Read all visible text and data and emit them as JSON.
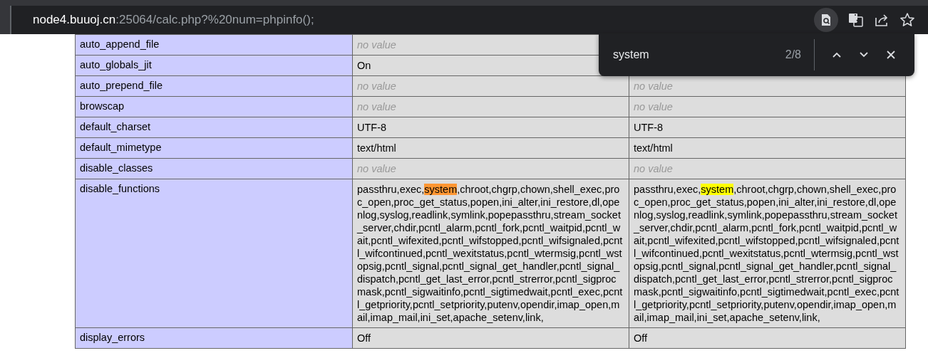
{
  "address_bar": {
    "host": "node4.buuoj.cn",
    "path": ":25064/calc.php?%20num=phpinfo();",
    "find_icon_active": true
  },
  "find_bar": {
    "query": "system",
    "count": "2/8"
  },
  "table": {
    "rows": [
      {
        "directive": "auto_append_file",
        "local": {
          "kind": "novalue",
          "text": "no value"
        }
      },
      {
        "directive": "auto_globals_jit",
        "local": {
          "kind": "plain",
          "text": "On"
        }
      },
      {
        "directive": "auto_prepend_file",
        "local": {
          "kind": "novalue",
          "text": "no value"
        },
        "master": {
          "kind": "novalue",
          "text": "no value"
        }
      },
      {
        "directive": "browscap",
        "local": {
          "kind": "novalue",
          "text": "no value"
        },
        "master": {
          "kind": "novalue",
          "text": "no value"
        }
      },
      {
        "directive": "default_charset",
        "local": {
          "kind": "plain",
          "text": "UTF-8"
        },
        "master": {
          "kind": "plain",
          "text": "UTF-8"
        }
      },
      {
        "directive": "default_mimetype",
        "local": {
          "kind": "plain",
          "text": "text/html"
        },
        "master": {
          "kind": "plain",
          "text": "text/html"
        }
      },
      {
        "directive": "disable_classes",
        "local": {
          "kind": "novalue",
          "text": "no value"
        },
        "master": {
          "kind": "novalue",
          "text": "no value"
        }
      },
      {
        "directive": "disable_functions",
        "local": {
          "kind": "plain",
          "segments": [
            {
              "text": "passthru,exec,"
            },
            {
              "text": "system",
              "match": true,
              "current": true
            },
            {
              "text": ",chroot,chgrp,chown,shell_exec,proc_open,proc_get_status,popen,ini_alter,ini_restore,dl,openlog,syslog,readlink,symlink,popepassthru,stream_socket_server,chdir,pcntl_alarm,pcntl_fork,pcntl_waitpid,pcntl_wait,pcntl_wifexited,pcntl_wifstopped,pcntl_wifsignaled,pcntl_wifcontinued,pcntl_wexitstatus,pcntl_wtermsig,pcntl_wstopsig,pcntl_signal,pcntl_signal_get_handler,pcntl_signal_dispatch,pcntl_get_last_error,pcntl_strerror,pcntl_sigprocmask,pcntl_sigwaitinfo,pcntl_sigtimedwait,pcntl_exec,pcntl_getpriority,pcntl_setpriority,putenv,opendir,imap_open,mail,imap_mail,ini_set,apache_setenv,link,"
            }
          ]
        },
        "master": {
          "kind": "plain",
          "segments": [
            {
              "text": "passthru,exec,"
            },
            {
              "text": "system",
              "match": true,
              "current": false
            },
            {
              "text": ",chroot,chgrp,chown,shell_exec,proc_open,proc_get_status,popen,ini_alter,ini_restore,dl,openlog,syslog,readlink,symlink,popepassthru,stream_socket_server,chdir,pcntl_alarm,pcntl_fork,pcntl_waitpid,pcntl_wait,pcntl_wifexited,pcntl_wifstopped,pcntl_wifsignaled,pcntl_wifcontinued,pcntl_wexitstatus,pcntl_wtermsig,pcntl_wstopsig,pcntl_signal,pcntl_signal_get_handler,pcntl_signal_dispatch,pcntl_get_last_error,pcntl_strerror,pcntl_sigprocmask,pcntl_sigwaitinfo,pcntl_sigtimedwait,pcntl_exec,pcntl_getpriority,pcntl_setpriority,putenv,opendir,imap_open,mail,imap_mail,ini_set,apache_setenv,link,"
            }
          ]
        }
      },
      {
        "directive": "display_errors",
        "local": {
          "kind": "plain",
          "text": "Off"
        },
        "master": {
          "kind": "plain",
          "text": "Off"
        }
      }
    ]
  }
}
